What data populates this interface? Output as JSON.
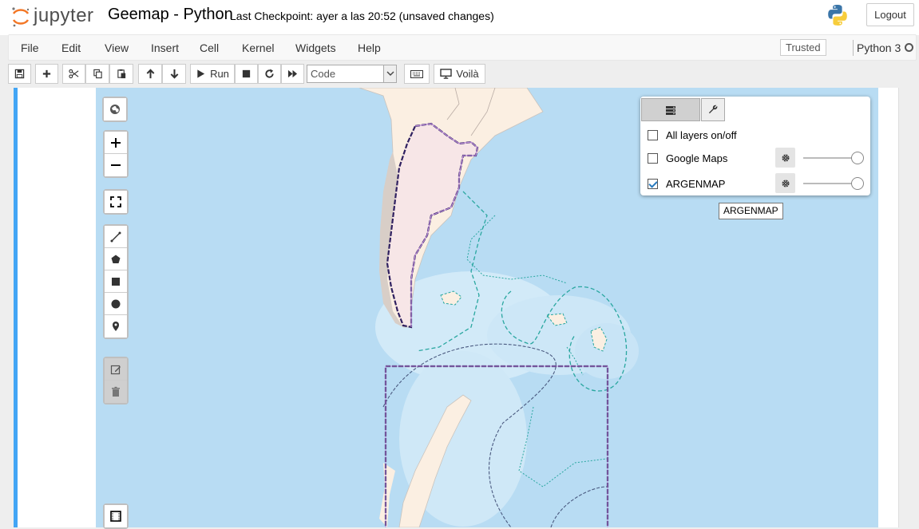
{
  "header": {
    "logo_text": "jupyter",
    "notebook_title": "Geemap - Python",
    "checkpoint": "Last Checkpoint: ayer a las 20:52  (unsaved changes)",
    "logout_label": "Logout"
  },
  "menubar": {
    "items": [
      "File",
      "Edit",
      "View",
      "Insert",
      "Cell",
      "Kernel",
      "Widgets",
      "Help"
    ],
    "trusted_label": "Trusted",
    "kernel_name": "Python 3"
  },
  "toolbar": {
    "run_label": "Run",
    "cell_type": "Code",
    "voila_label": "Voilà"
  },
  "layer_panel": {
    "all_layers_label": "All layers on/off",
    "layers": [
      {
        "name": "Google Maps",
        "checked": false
      },
      {
        "name": "ARGENMAP",
        "checked": true
      }
    ],
    "tooltip": "ARGENMAP"
  },
  "colors": {
    "cell_border": "#42a5f5",
    "ocean": "#b8dcf3",
    "land": "#fbefe2",
    "boundary": "#2f2060",
    "highlight": "#b98ad6"
  }
}
